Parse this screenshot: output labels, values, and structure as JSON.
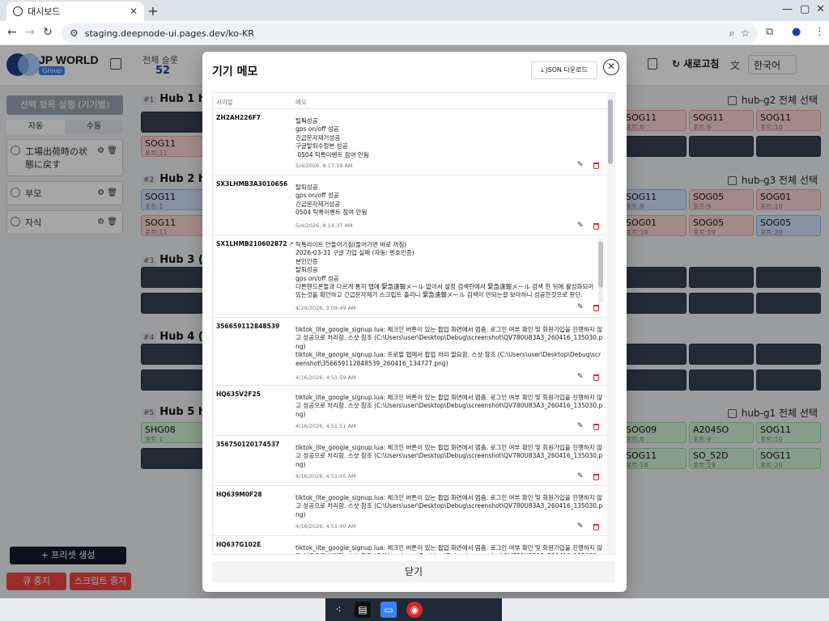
{
  "browser": {
    "tab_title": "대시보드",
    "url": "staging.deepnode-ui.pages.dev/ko-KR"
  },
  "app": {
    "brand": "JP WORLD",
    "brand_sub": "Group",
    "summary_label": "전체 슬롯",
    "summary_value": "52",
    "refresh_label": "새로고침",
    "language": "한국어",
    "sidebar": {
      "run_label": "선택 항목 실행 (기기별)",
      "tab_auto": "자동",
      "tab_manual": "수동",
      "items": [
        {
          "label": "工場出荷時の状態に戻す"
        },
        {
          "label": "부모"
        },
        {
          "label": "자식"
        }
      ],
      "preset_label": "+ 프리셋 생성",
      "queue_stop": "큐 중지",
      "script_stop": "스크립트 중지"
    },
    "hubs": [
      {
        "num": "#1",
        "name": "Hub 1 hu",
        "select": "hub-g2 전체 선택"
      },
      {
        "num": "#2",
        "name": "Hub 2 hu",
        "select": "hub-g3 전체 선택"
      },
      {
        "num": "#3",
        "name": "Hub 3 (연"
      },
      {
        "num": "#4",
        "name": "Hub 4 (연"
      },
      {
        "num": "#5",
        "name": "Hub 5 hu",
        "select": "hub-g1 전체 선택"
      }
    ],
    "cards": [
      {
        "k": "SOG11",
        "p": "포트:11"
      },
      {
        "k": "SOG11",
        "p": "포트:8"
      },
      {
        "k": "SOG11",
        "p": "포트:9"
      },
      {
        "k": "SOG11",
        "p": "포트:10"
      },
      {
        "k": "SOG11",
        "p": "포트:1"
      },
      {
        "k": "SOG11",
        "p": "포트:8"
      },
      {
        "k": "SOG05",
        "p": "포트:9"
      },
      {
        "k": "SOG01",
        "p": "포트:10"
      },
      {
        "k": "SOG11",
        "p": "포트:11"
      },
      {
        "k": "SOG01",
        "p": "포트:18"
      },
      {
        "k": "SOG05",
        "p": "포트:19"
      },
      {
        "k": "SOG05",
        "p": "포트:20"
      },
      {
        "k": "SHG08",
        "p": "포트:1"
      },
      {
        "k": "SOG09",
        "p": "포트:8"
      },
      {
        "k": "A204SO",
        "p": "포트:9"
      },
      {
        "k": "SOG11",
        "p": "포트:10"
      },
      {
        "k": "SOG11",
        "p": "포트:18"
      },
      {
        "k": "SO_52D",
        "p": "포트:19"
      },
      {
        "k": "SOG11",
        "p": "포트:20"
      }
    ]
  },
  "modal": {
    "title": "기기 메모",
    "json_button": "JSON 다운로드",
    "col_serial": "시리얼",
    "col_memo": "메모",
    "close_button": "닫기",
    "rows": [
      {
        "serial": "ZH2AH226F7",
        "memo": "틸튁성공\ngps on/off 성공\n긴급문자제거성공\n구글탈퇴수정본 성공\n 0504 틱톡이벤트 참여 안됨",
        "ts": "5/4/2026, 8:17:19 AM"
      },
      {
        "serial": "SX3LHMB3A3010656",
        "memo": "탈퇴성공\ngps on/off 성공\n긴급문자제거성공\n0504 틱톡이벤트 참여 안됨",
        "ts": "5/4/2026, 8:14:37 AM"
      },
      {
        "serial": "SX1LHMB210602872",
        "memo": "틱톡라이트 안들어가짐(들어가면 바로 꺼짐)\n2026-03-31 구글 가입 실패 (자동: 번호인증)\n본인인증\n탈퇴성공\ngps on/off 성공\n다른핸드폰들과 다르게 통지 탭에 緊急速報メール 없어서 설정 검색란에서 緊急速報メール 검색 한 뒤에 활성화되어 있는것을 확인하고 긴급문자제거 스크립트 돌리니 緊急速報メール 검색이 안되는걸 보아하니 성공한것으로 판단.\n구글탈퇴수정본성공",
        "ts": "4/20/2026, 3:09:49 AM"
      },
      {
        "serial": "356659112848539",
        "memo": "tiktok_lite_google_signup.lua: 체크인 버튼이 있는 팝업 화면에서 멈춤. 로그인 여부 확인 및 회원가입을 진행하지 않고 성공으로 처리함. 스샷 참조 (C:\\Users\\user\\Desktop\\Debug\\screenshot\\QV780U83A3_260416_135030.png)\ntiktok_lite_google_signup.lua: 프로필 탭에서 팝업 처리 필요함. 스샷 참조 (C:\\Users\\user\\Desktop\\Debug\\screenshot\\356659112848539_260416_134727.png)",
        "ts": "4/16/2026, 4:51:59 AM"
      },
      {
        "serial": "HQ635V2F25",
        "memo": "tiktok_lite_google_signup.lua: 체크인 버튼이 있는 팝업 화면에서 멈춤. 로그인 여부 확인 및 회원가입을 진행하지 않고 성공으로 처리함. 스샷 참조 (C:\\Users\\user\\Desktop\\Debug\\screenshot\\QV780U83A3_260416_135030.png)",
        "ts": "4/16/2026, 4:51:51 AM"
      },
      {
        "serial": "356750120174537",
        "memo": "tiktok_lite_google_signup.lua: 체크인 버튼이 있는 팝업 화면에서 멈춤. 로그인 여부 확인 및 회원가입을 진행하지 않고 성공으로 처리함. 스샷 참조 (C:\\Users\\user\\Desktop\\Debug\\screenshot\\QV780U83A3_260416_135030.png)",
        "ts": "4/16/2026, 4:51:45 AM"
      },
      {
        "serial": "HQ639M0F28",
        "memo": "tiktok_lite_google_signup.lua: 체크인 버튼이 있는 팝업 화면에서 멈춤. 로그인 여부 확인 및 회원가입을 진행하지 않고 성공으로 처리함. 스샷 참조 (C:\\Users\\user\\Desktop\\Debug\\screenshot\\QV780U83A3_260416_135030.png)",
        "ts": "4/16/2026, 4:51:40 AM"
      },
      {
        "serial": "HQ637G102E",
        "memo": "tiktok_lite_google_signup.lua: 체크인 버튼이 있는 팝업 화면에서 멈춤. 로그인 여부 확인 및 회원가입을 진행하지 않고 성공으로 처리함. 스샷 참조 (C:\\Users\\user\\Desktop\\Debug\\screenshot\\QV780U83A3_260416_135030.png)",
        "ts": ""
      }
    ]
  }
}
